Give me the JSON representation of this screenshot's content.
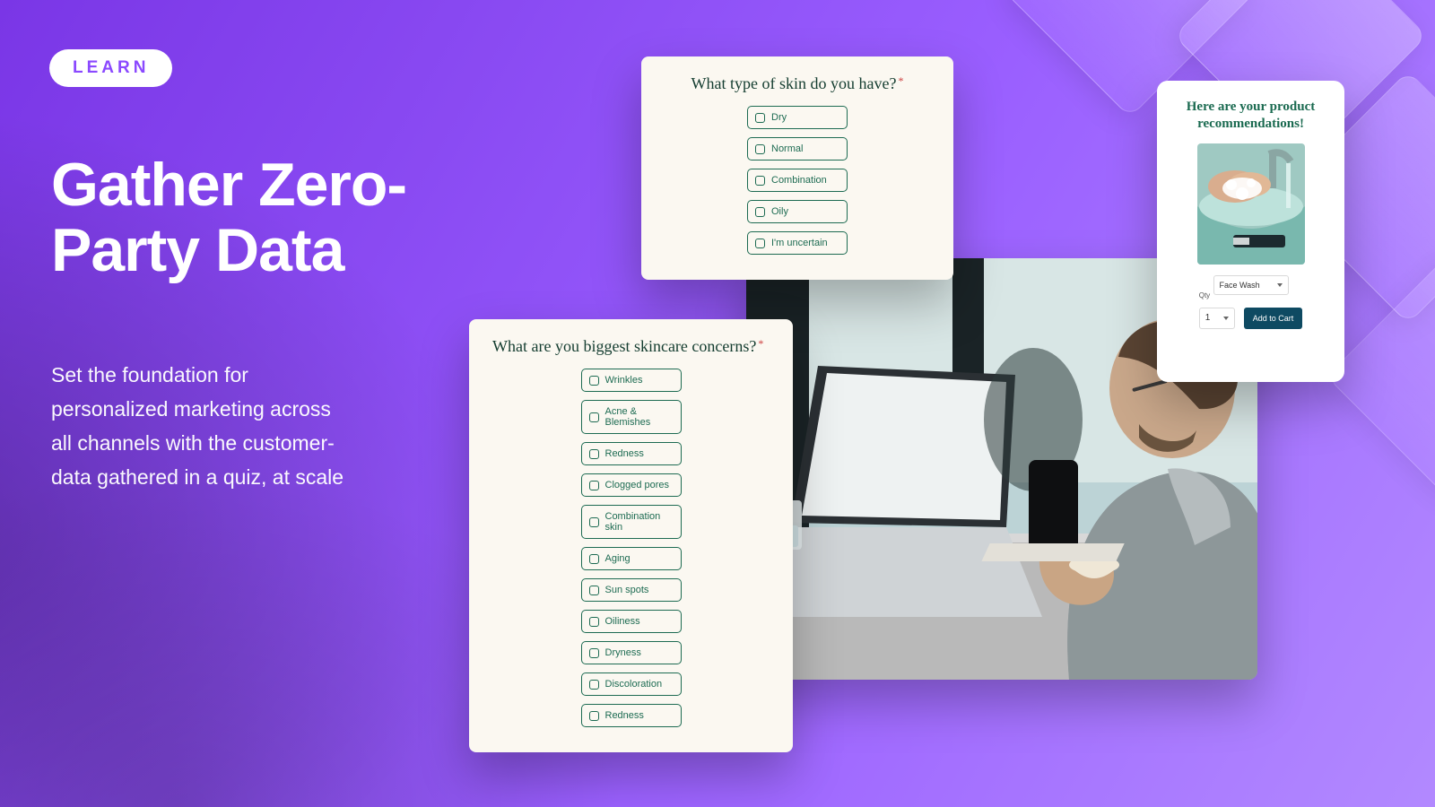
{
  "badge": "LEARN",
  "headline": "Gather Zero-Party Data",
  "subcopy": "Set the foundation for personalized marketing across all channels with the customer-data gathered in a quiz, at scale",
  "quiz1": {
    "title": "What type of skin do you have?",
    "options": [
      "Dry",
      "Normal",
      "Combination",
      "Oily",
      "I'm uncertain"
    ]
  },
  "quiz2": {
    "title": "What are you biggest skincare concerns?",
    "options": [
      "Wrinkles",
      "Acne & Blemishes",
      "Redness",
      "Clogged pores",
      "Combination skin",
      "Aging",
      "Sun spots",
      "Oiliness",
      "Dryness",
      "Discoloration",
      "Redness"
    ]
  },
  "reco": {
    "heading": "Here are your product recommendations!",
    "variant_label": "Face Wash",
    "qty_label": "Qty",
    "qty_value": "1",
    "add_label": "Add to Cart"
  }
}
